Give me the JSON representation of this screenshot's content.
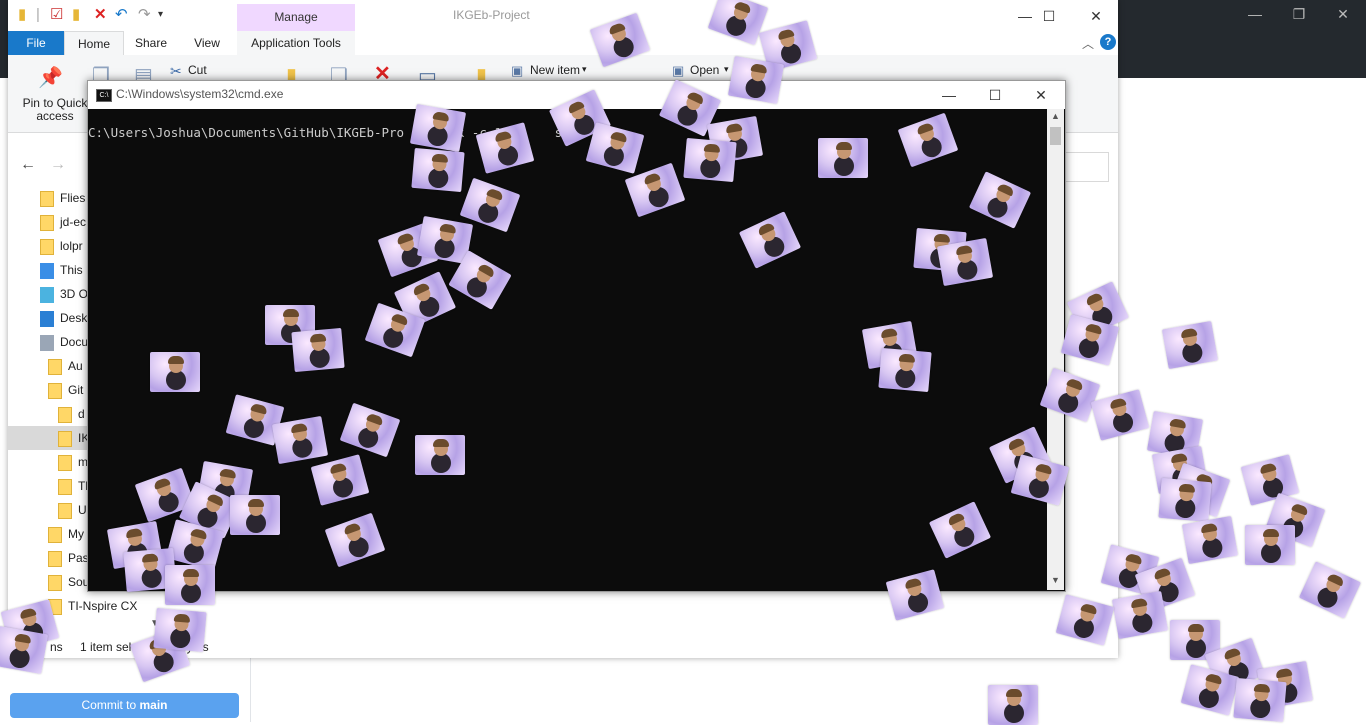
{
  "background_app": {
    "commit_button": {
      "prefix": "Commit to ",
      "branch": "main"
    }
  },
  "explorer": {
    "title": "IKGEb-Project",
    "contextual_tab": "Manage",
    "tabs": [
      "File",
      "Home",
      "Share",
      "View",
      "Application Tools"
    ],
    "ribbon": {
      "pin_label_1": "Pin to Quick",
      "pin_label_2": "access",
      "cut": "Cut",
      "new_item": "New item",
      "open": "Open"
    },
    "tree": [
      {
        "label": "Flies",
        "indent": 1
      },
      {
        "label": "jd-ec",
        "indent": 1
      },
      {
        "label": "lolpr",
        "indent": 1
      },
      {
        "label": "This P",
        "indent": 0,
        "icon": "pc-icon"
      },
      {
        "label": "3D O",
        "indent": 1,
        "icon": "3d-icon"
      },
      {
        "label": "Desk",
        "indent": 1,
        "icon": "desktop-icon"
      },
      {
        "label": "Docu",
        "indent": 1,
        "icon": "documents-icon"
      },
      {
        "label": "Au",
        "indent": 2
      },
      {
        "label": "Git",
        "indent": 2
      },
      {
        "label": "d",
        "indent": 3
      },
      {
        "label": "IK",
        "indent": 3,
        "selected": true
      },
      {
        "label": "m",
        "indent": 3
      },
      {
        "label": "Tl",
        "indent": 3
      },
      {
        "label": "U",
        "indent": 3
      },
      {
        "label": "My",
        "indent": 2
      },
      {
        "label": "Pas",
        "indent": 2
      },
      {
        "label": "Sound reco",
        "indent": 2
      },
      {
        "label": "TI-Nspire CX",
        "indent": 2
      }
    ],
    "status": {
      "count": "ns",
      "selected": "1 item sele",
      "size": "bytes"
    }
  },
  "cmd": {
    "title": "C:\\Windows\\system32\\cmd.exe",
    "line": "C:\\Users\\Joshua\\Documents\\GitHub\\IKGEb-Pro     ick -c 100     s"
  }
}
